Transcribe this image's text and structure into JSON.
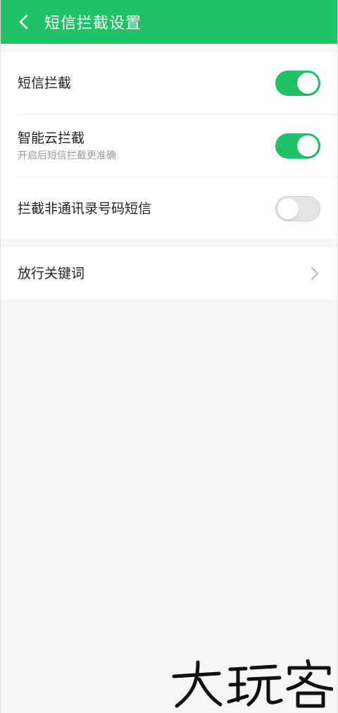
{
  "header": {
    "title": "短信拦截设置",
    "back_icon": "chevron-left-icon",
    "color": "#21c165"
  },
  "settings": {
    "sms_block": {
      "title": "短信拦截",
      "enabled": true
    },
    "smart_cloud_block": {
      "title": "智能云拦截",
      "subtitle": "开启后短信拦截更准确",
      "enabled": true
    },
    "block_unknown_contacts": {
      "title": "拦截非通讯录号码短信",
      "enabled": false
    }
  },
  "keywords": {
    "title": "放行关键词",
    "chevron_icon": "chevron-right-icon"
  },
  "watermark": {
    "text": "大玩客"
  },
  "colors": {
    "accent": "#21c165",
    "background": "#f7f7f7",
    "card": "#ffffff"
  }
}
